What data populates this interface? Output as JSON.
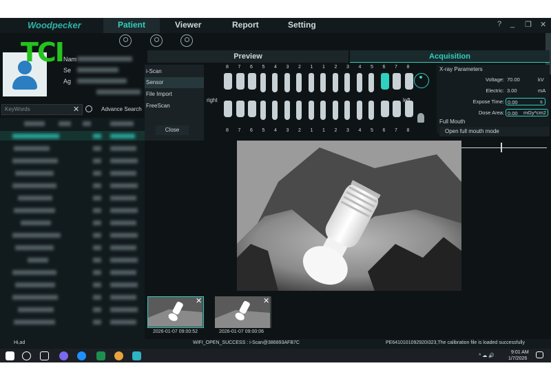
{
  "app": {
    "brand": "Woodpecker",
    "logo_text": "TCI",
    "nav": [
      "Patient",
      "Viewer",
      "Report",
      "Setting"
    ],
    "window_controls": [
      "?",
      "_",
      "❐",
      "✕"
    ]
  },
  "toolbar": {
    "icons": [
      "add-patient-icon",
      "edit-patient-icon",
      "patient-search-icon"
    ]
  },
  "patient_panel": {
    "labels": [
      "Nam",
      "Se",
      "Ag"
    ],
    "search": {
      "placeholder": "KeyWords",
      "clear": "✕",
      "advance_label": "Advance Search"
    }
  },
  "scan_menu": {
    "items": [
      "i-Scan",
      "Sensor",
      "File Import",
      "FreeScan"
    ],
    "active_index": 1,
    "close_label": "Close"
  },
  "tabs": {
    "preview": "Preview",
    "acquisition": "Acquisition"
  },
  "tooth_chart": {
    "upper_numbers": [
      "8",
      "7",
      "6",
      "5",
      "4",
      "3",
      "2",
      "1",
      "1",
      "2",
      "3",
      "4",
      "5",
      "6",
      "7",
      "8"
    ],
    "lower_numbers": [
      "8",
      "7",
      "6",
      "5",
      "4",
      "3",
      "2",
      "1",
      "1",
      "2",
      "3",
      "4",
      "5",
      "6",
      "7",
      "8"
    ],
    "right_label": "right",
    "left_label": "left",
    "highlight_color": "#2fd0c0"
  },
  "xray_params": {
    "title": "X-ray Parameters",
    "voltage": {
      "label": "Voltage:",
      "value": "70.00",
      "unit": "kV"
    },
    "electric": {
      "label": "Electric:",
      "value": "3.00",
      "unit": "mA"
    },
    "expose_time": {
      "label": "Expose Time:",
      "value": "0.00",
      "unit": "s"
    },
    "dose_area": {
      "label": "Dose Area:",
      "value": "0.00",
      "unit": "mGy*cm2"
    },
    "full_mouth_label": "Full Mouth",
    "open_full_mouth": "Open full mouth mode"
  },
  "thumbnails": [
    {
      "date": "2026-01-07 09:00:52",
      "active": true
    },
    {
      "date": "2026-01-07 09:00:06",
      "active": false
    }
  ],
  "status": {
    "left": "Hi,ad",
    "center": "WIFI_OPEN_SUCCESS : i-Scan@386893AFB7C",
    "right": "PE6410101092920I323,The calibration file is loaded successfully"
  },
  "taskbar": {
    "time": "9:01 AM",
    "date": "1/7/2026",
    "tray": "^ ☁ 🔊"
  },
  "colors": {
    "accent": "#2fd0c0",
    "logo": "#24c21d",
    "background": "#0e1416"
  }
}
